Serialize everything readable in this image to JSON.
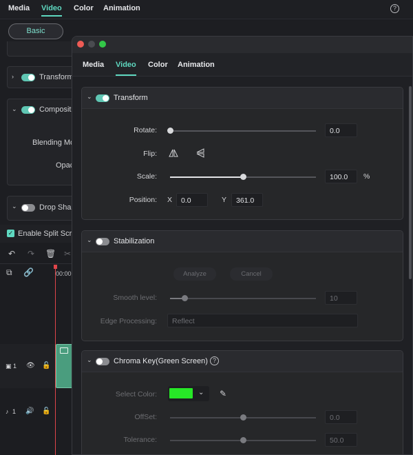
{
  "app": {
    "tabs": [
      "Media",
      "Video",
      "Color",
      "Animation"
    ],
    "active_tab": "Video",
    "help_label": "?",
    "basic_label": "Basic",
    "panels": {
      "transform": "Transform",
      "compositing": "Compositi",
      "blending": "Blending Mo",
      "opacity": "Opac",
      "drop_shadow": "Drop Shac"
    },
    "split_screen": "Enable Split Scre",
    "timecode": "00:00",
    "track_video": "1",
    "track_audio": "1"
  },
  "dialog": {
    "tabs": [
      "Media",
      "Video",
      "Color",
      "Animation"
    ],
    "active_tab": "Video",
    "transform": {
      "title": "Transform",
      "enabled": true,
      "rotate_label": "Rotate:",
      "rotate_value": "0.0",
      "rotate_fraction": 0.0,
      "flip_label": "Flip:",
      "scale_label": "Scale:",
      "scale_value": "100.0",
      "scale_unit": "%",
      "scale_fraction": 0.5,
      "position_label": "Position:",
      "x_label": "X",
      "x_value": "0.0",
      "y_label": "Y",
      "y_value": "361.0"
    },
    "stabilization": {
      "title": "Stabilization",
      "enabled": false,
      "analyze_label": "Analyze",
      "cancel_label": "Cancel",
      "smooth_label": "Smooth level:",
      "smooth_value": "10",
      "smooth_fraction": 0.1,
      "edge_label": "Edge Processing:",
      "edge_value": "Reflect"
    },
    "chroma": {
      "title": "Chroma Key(Green Screen)",
      "enabled": false,
      "help_label": "?",
      "select_color_label": "Select Color:",
      "selected_color": "#27e827",
      "offset_label": "OffSet:",
      "offset_value": "0.0",
      "offset_fraction": 0.5,
      "tolerance_label": "Tolerance:",
      "tolerance_value": "50.0",
      "tolerance_fraction": 0.5
    }
  },
  "colors": {
    "accent": "#5fd9c1",
    "toggle_on": "#5fc6b3",
    "playhead": "#e0454a"
  }
}
